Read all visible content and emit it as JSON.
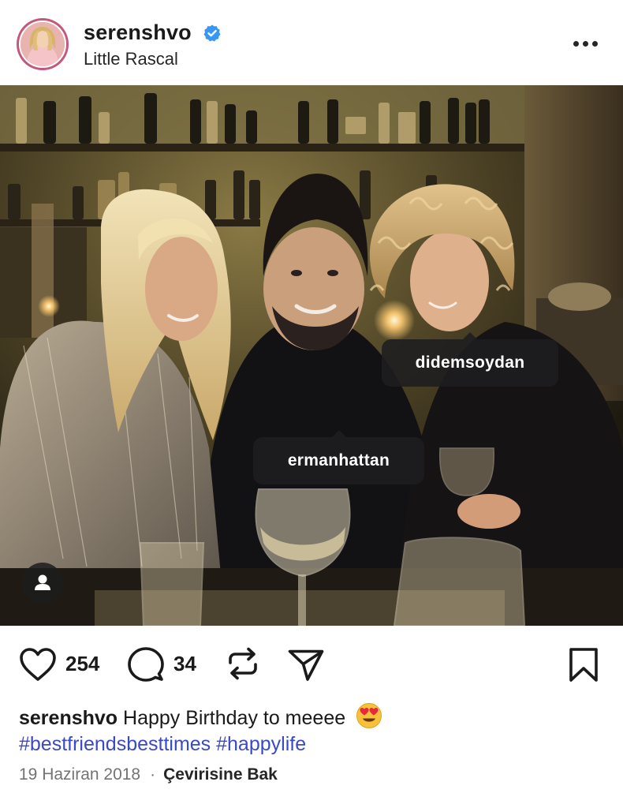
{
  "header": {
    "username": "serenshvo",
    "subtitle": "Little Rascal",
    "verified_icon": "verified-badge-icon",
    "more_icon": "more-options-icon"
  },
  "photo": {
    "tags": [
      {
        "username": "didemsoydan"
      },
      {
        "username": "ermanhattan"
      }
    ],
    "user_tags_icon": "person-icon"
  },
  "actions": {
    "like_count": "254",
    "comment_count": "34",
    "icons": [
      "heart-icon",
      "comment-icon",
      "repost-icon",
      "share-icon",
      "bookmark-icon"
    ]
  },
  "caption": {
    "username": "serenshvo",
    "text": "Happy Birthday to meeee",
    "emoji": "heart-eyes-emoji",
    "hashtags": "#bestfriendsbesttimes #happylife"
  },
  "meta": {
    "date": "19 Haziran 2018",
    "separator": "·",
    "translate": "Çevirisine Bak"
  },
  "colors": {
    "verified": "#3897f0",
    "hashtag": "#3a49c7",
    "avatar_ring": "#c4577a",
    "tag_bg": "#1e1e20"
  }
}
